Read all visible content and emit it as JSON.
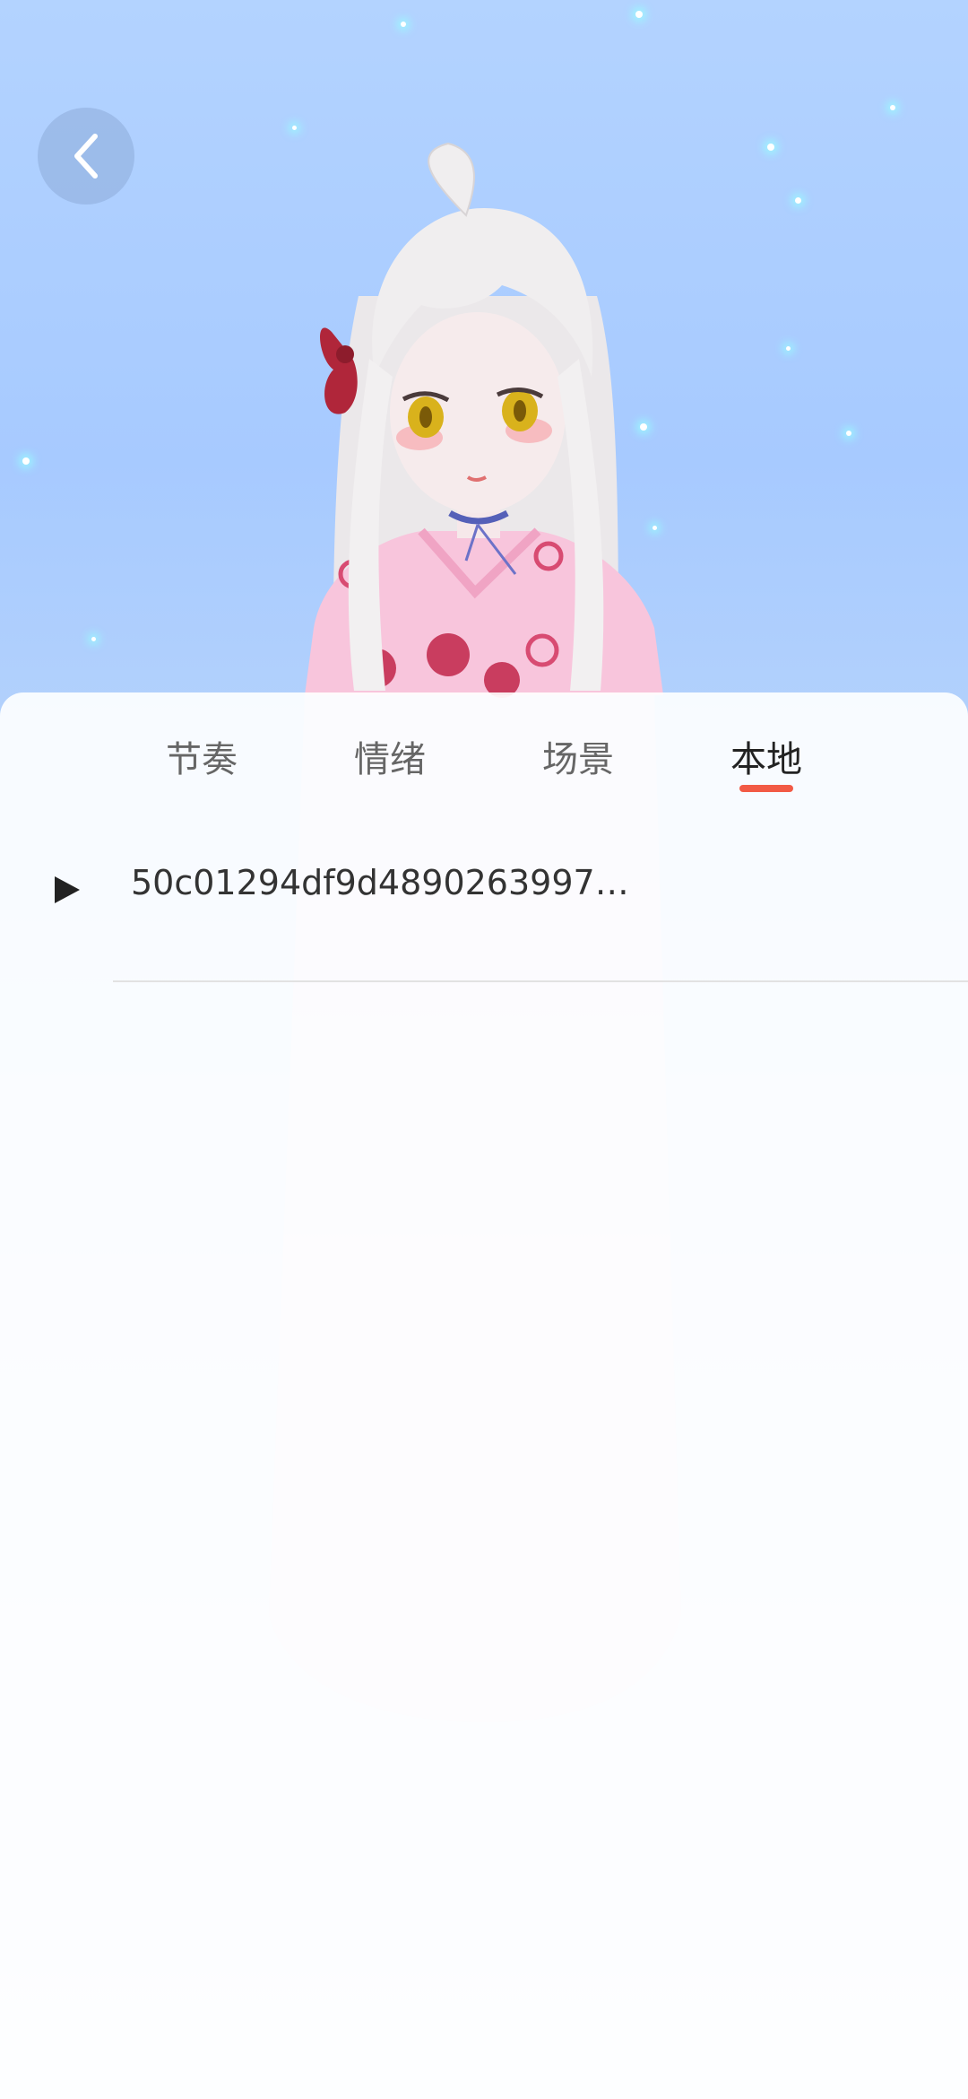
{
  "tabs": [
    {
      "label": "节奏",
      "active": false
    },
    {
      "label": "情绪",
      "active": false
    },
    {
      "label": "场景",
      "active": false
    },
    {
      "label": "本地",
      "active": true
    }
  ],
  "list": {
    "items": [
      {
        "title": "50c01294df9d4890263997…",
        "icon": "play-icon"
      }
    ]
  },
  "icons": {
    "back": "chevron-left-icon",
    "play": "play-icon"
  },
  "colors": {
    "accent": "#f25a45",
    "sky": "#b3d3ff",
    "panel": "#ffffff",
    "active_tab_text": "#222222",
    "inactive_tab_text": "#666666"
  }
}
